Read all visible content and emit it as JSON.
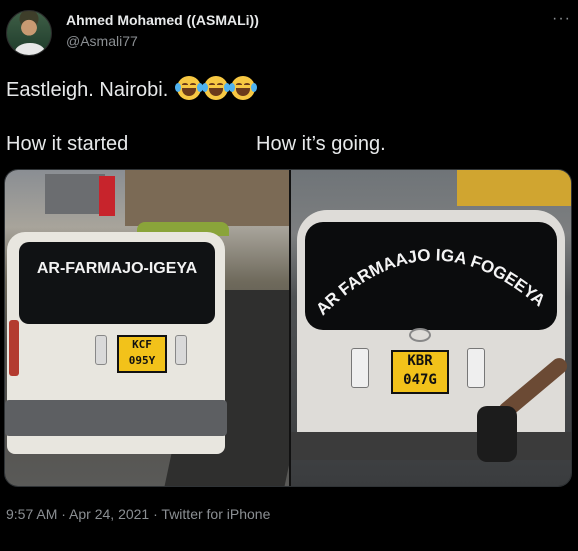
{
  "author": {
    "name": "Ahmed Mohamed ((ASMALi))",
    "handle": "@Asmali77",
    "avatar_icon": "avatar"
  },
  "more_icon": "more-icon",
  "tweet": {
    "text": "Eastleigh. Nairobi.",
    "emoji_name": "face-with-tears-of-joy",
    "emoji_count": 3,
    "caption_left": "How it started",
    "caption_right": "How it’s going."
  },
  "photos": {
    "left": {
      "rear_window_text": "AR-FARMAJO-IGEYA",
      "plate_line1": "KCF",
      "plate_line2": "095Y"
    },
    "right": {
      "rear_window_text": "AR FARMAAJO IGA FOGEEYA",
      "plate_line1": "KBR",
      "plate_line2": "047G"
    }
  },
  "footer": {
    "time": "9:57 AM",
    "date": "Apr 24, 2021",
    "client": "Twitter for iPhone"
  }
}
